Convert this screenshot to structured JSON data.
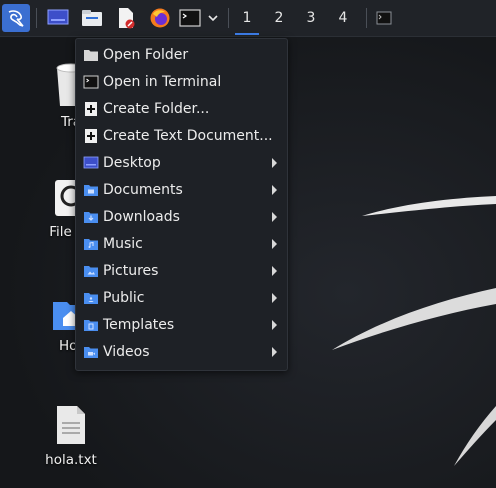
{
  "taskbar": {
    "workspaces": [
      "1",
      "2",
      "3",
      "4"
    ],
    "active_workspace": "1",
    "launchers": [
      "kali-menu-icon",
      "desktop-icon",
      "file-manager-icon",
      "text-editor-icon",
      "firefox-icon",
      "terminal-icon",
      "chevron-down-icon"
    ]
  },
  "desktop_icons": {
    "trash": "Tra",
    "filesystem": "File Sy",
    "home": "Hor",
    "hola": "hola.txt"
  },
  "menu": {
    "items": [
      {
        "label": "Open Folder",
        "icon": "folder-icon"
      },
      {
        "label": "Open in Terminal",
        "icon": "terminal-icon"
      },
      {
        "label": "Create Folder...",
        "icon": "plus-icon"
      },
      {
        "label": "Create Text Document...",
        "icon": "plus-icon"
      },
      {
        "label": "Desktop",
        "icon": "desktop-folder-icon"
      },
      {
        "label": "Documents",
        "icon": "documents-folder-icon"
      },
      {
        "label": "Downloads",
        "icon": "downloads-folder-icon"
      },
      {
        "label": "Music",
        "icon": "music-folder-icon"
      },
      {
        "label": "Pictures",
        "icon": "pictures-folder-icon"
      },
      {
        "label": "Public",
        "icon": "public-folder-icon"
      },
      {
        "label": "Templates",
        "icon": "templates-folder-icon"
      },
      {
        "label": "Videos",
        "icon": "videos-folder-icon"
      }
    ]
  },
  "colors": {
    "accent": "#3d7eea",
    "folder_blue": "#4a8ef0",
    "menu_bg": "#1e2126",
    "taskbar_bg": "#202328"
  }
}
